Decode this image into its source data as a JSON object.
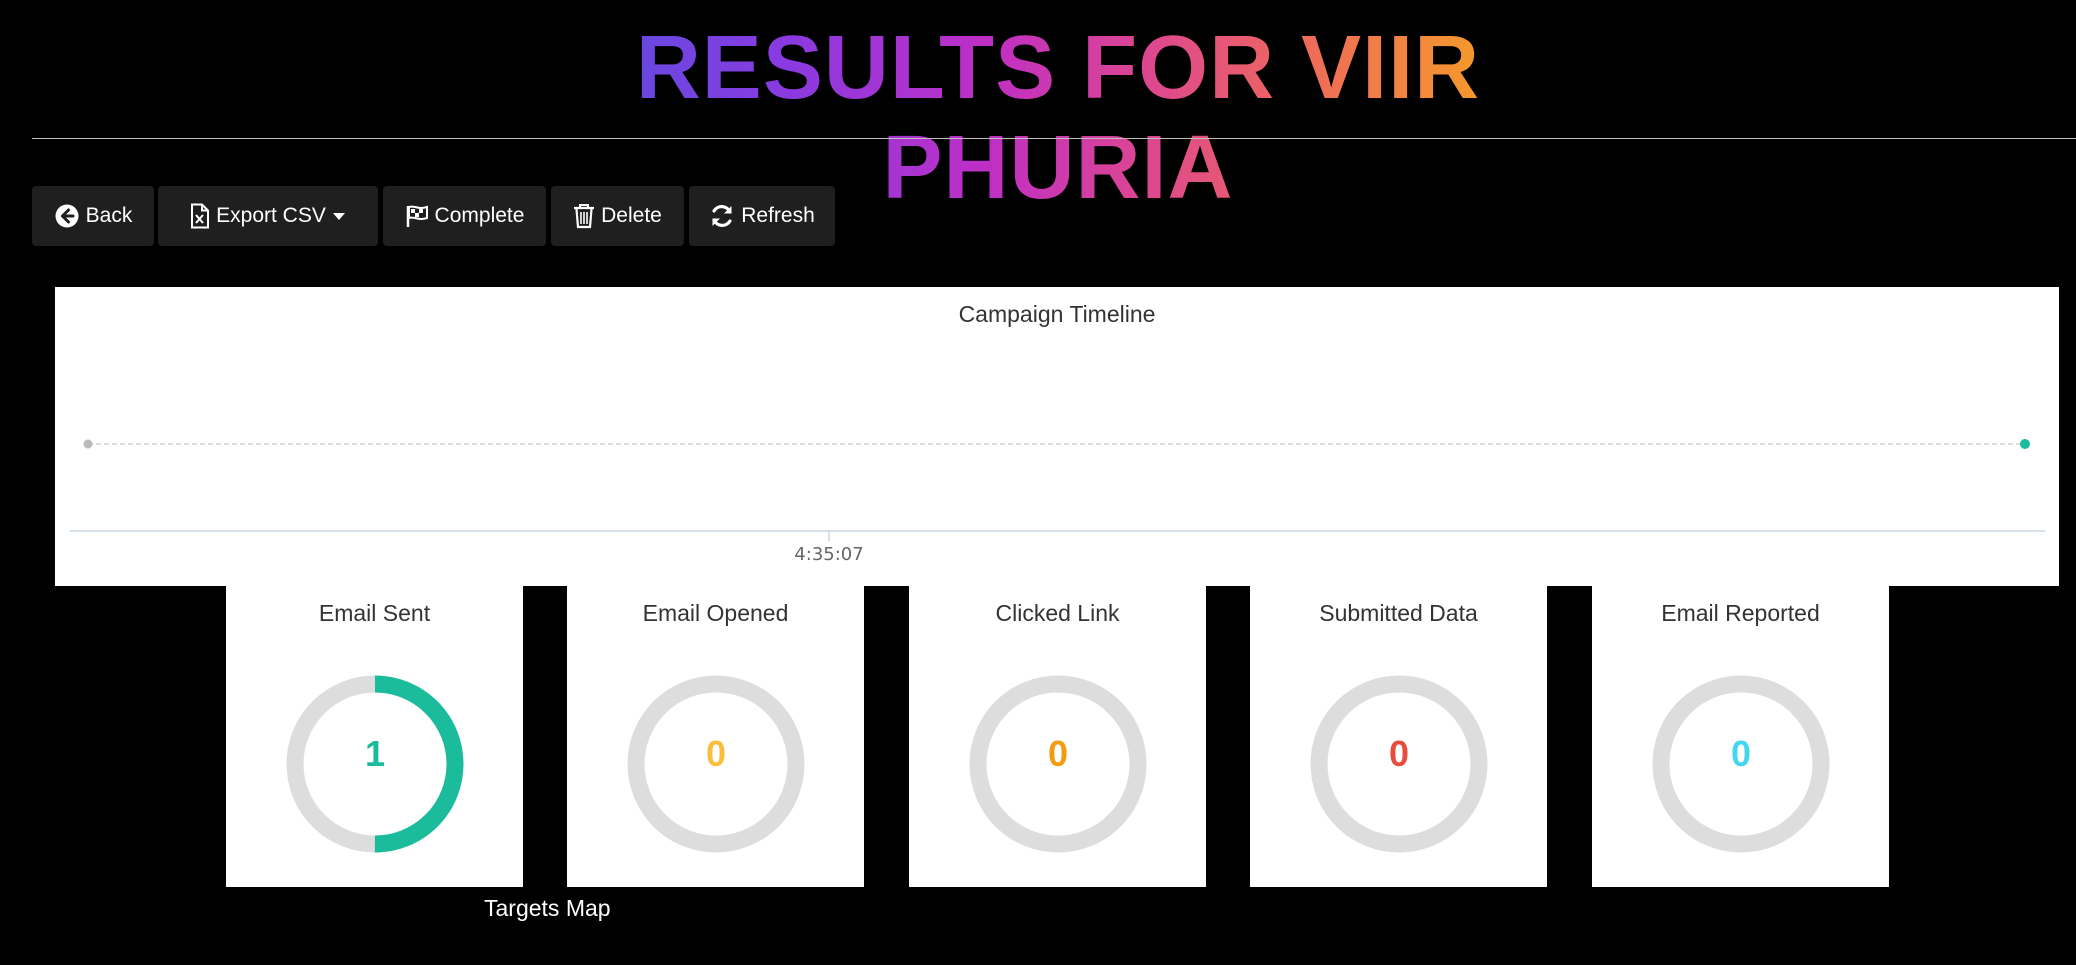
{
  "title": "RESULTS FOR VIIR PHURIA",
  "toolbar": {
    "back_label": "Back",
    "export_label": "Export CSV",
    "complete_label": "Complete",
    "delete_label": "Delete",
    "refresh_label": "Refresh"
  },
  "icons": {
    "back": "arrow-circle-left-icon",
    "export": "file-excel-icon",
    "export_caret": "caret-down-icon",
    "complete": "flag-checkered-icon",
    "delete": "trash-icon",
    "refresh": "refresh-icon"
  },
  "chart_data": {
    "type": "scatter",
    "title": "Campaign Timeline",
    "x_tick_labels": [
      "4:35:07"
    ],
    "points": [
      {
        "status": "launched",
        "color": "#bbbbbb"
      },
      {
        "status": "sent",
        "color": "#1abc9c"
      }
    ]
  },
  "stats": [
    {
      "label": "Email Sent",
      "value": "1",
      "fraction": 0.5,
      "color": "#1abc9c"
    },
    {
      "label": "Email Opened",
      "value": "0",
      "fraction": 0,
      "color": "#f9bf3b"
    },
    {
      "label": "Clicked Link",
      "value": "0",
      "fraction": 0,
      "color": "#f39c12"
    },
    {
      "label": "Submitted Data",
      "value": "0",
      "fraction": 0,
      "color": "#e74c3c"
    },
    {
      "label": "Email Reported",
      "value": "0",
      "fraction": 0,
      "color": "#45d6ef"
    }
  ],
  "targets_map_label": "Targets Map"
}
